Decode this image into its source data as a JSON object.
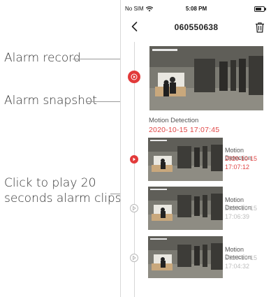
{
  "annotations": {
    "alarm_record": "Alarm record",
    "alarm_snapshot": "Alarm snapshot",
    "click_to_play_line1": "Click to play 20",
    "click_to_play_line2": "seconds alarm clips"
  },
  "status_bar": {
    "carrier": "No SIM",
    "time": "5:08 PM"
  },
  "nav": {
    "title": "060550638"
  },
  "records": [
    {
      "title": "Motion Detection",
      "timestamp": "2020-10-15  17:07:45",
      "active": true
    },
    {
      "title": "Motion Detection",
      "date": "2020-10-15",
      "time": "17:07:12",
      "active": true
    },
    {
      "title": "Motion Detection",
      "date": "2020-10-15",
      "time": "17:06:39",
      "active": false
    },
    {
      "title": "Motion Detection",
      "date": "2020-10-15",
      "time": "17:04:32",
      "active": false
    }
  ],
  "colors": {
    "accent_red": "#e23a3a",
    "timestamp_red": "#e04646",
    "inactive_grey": "#bdbdbd"
  },
  "icons": [
    "wifi-icon",
    "battery-icon",
    "back-icon",
    "trash-icon",
    "play-icon"
  ]
}
